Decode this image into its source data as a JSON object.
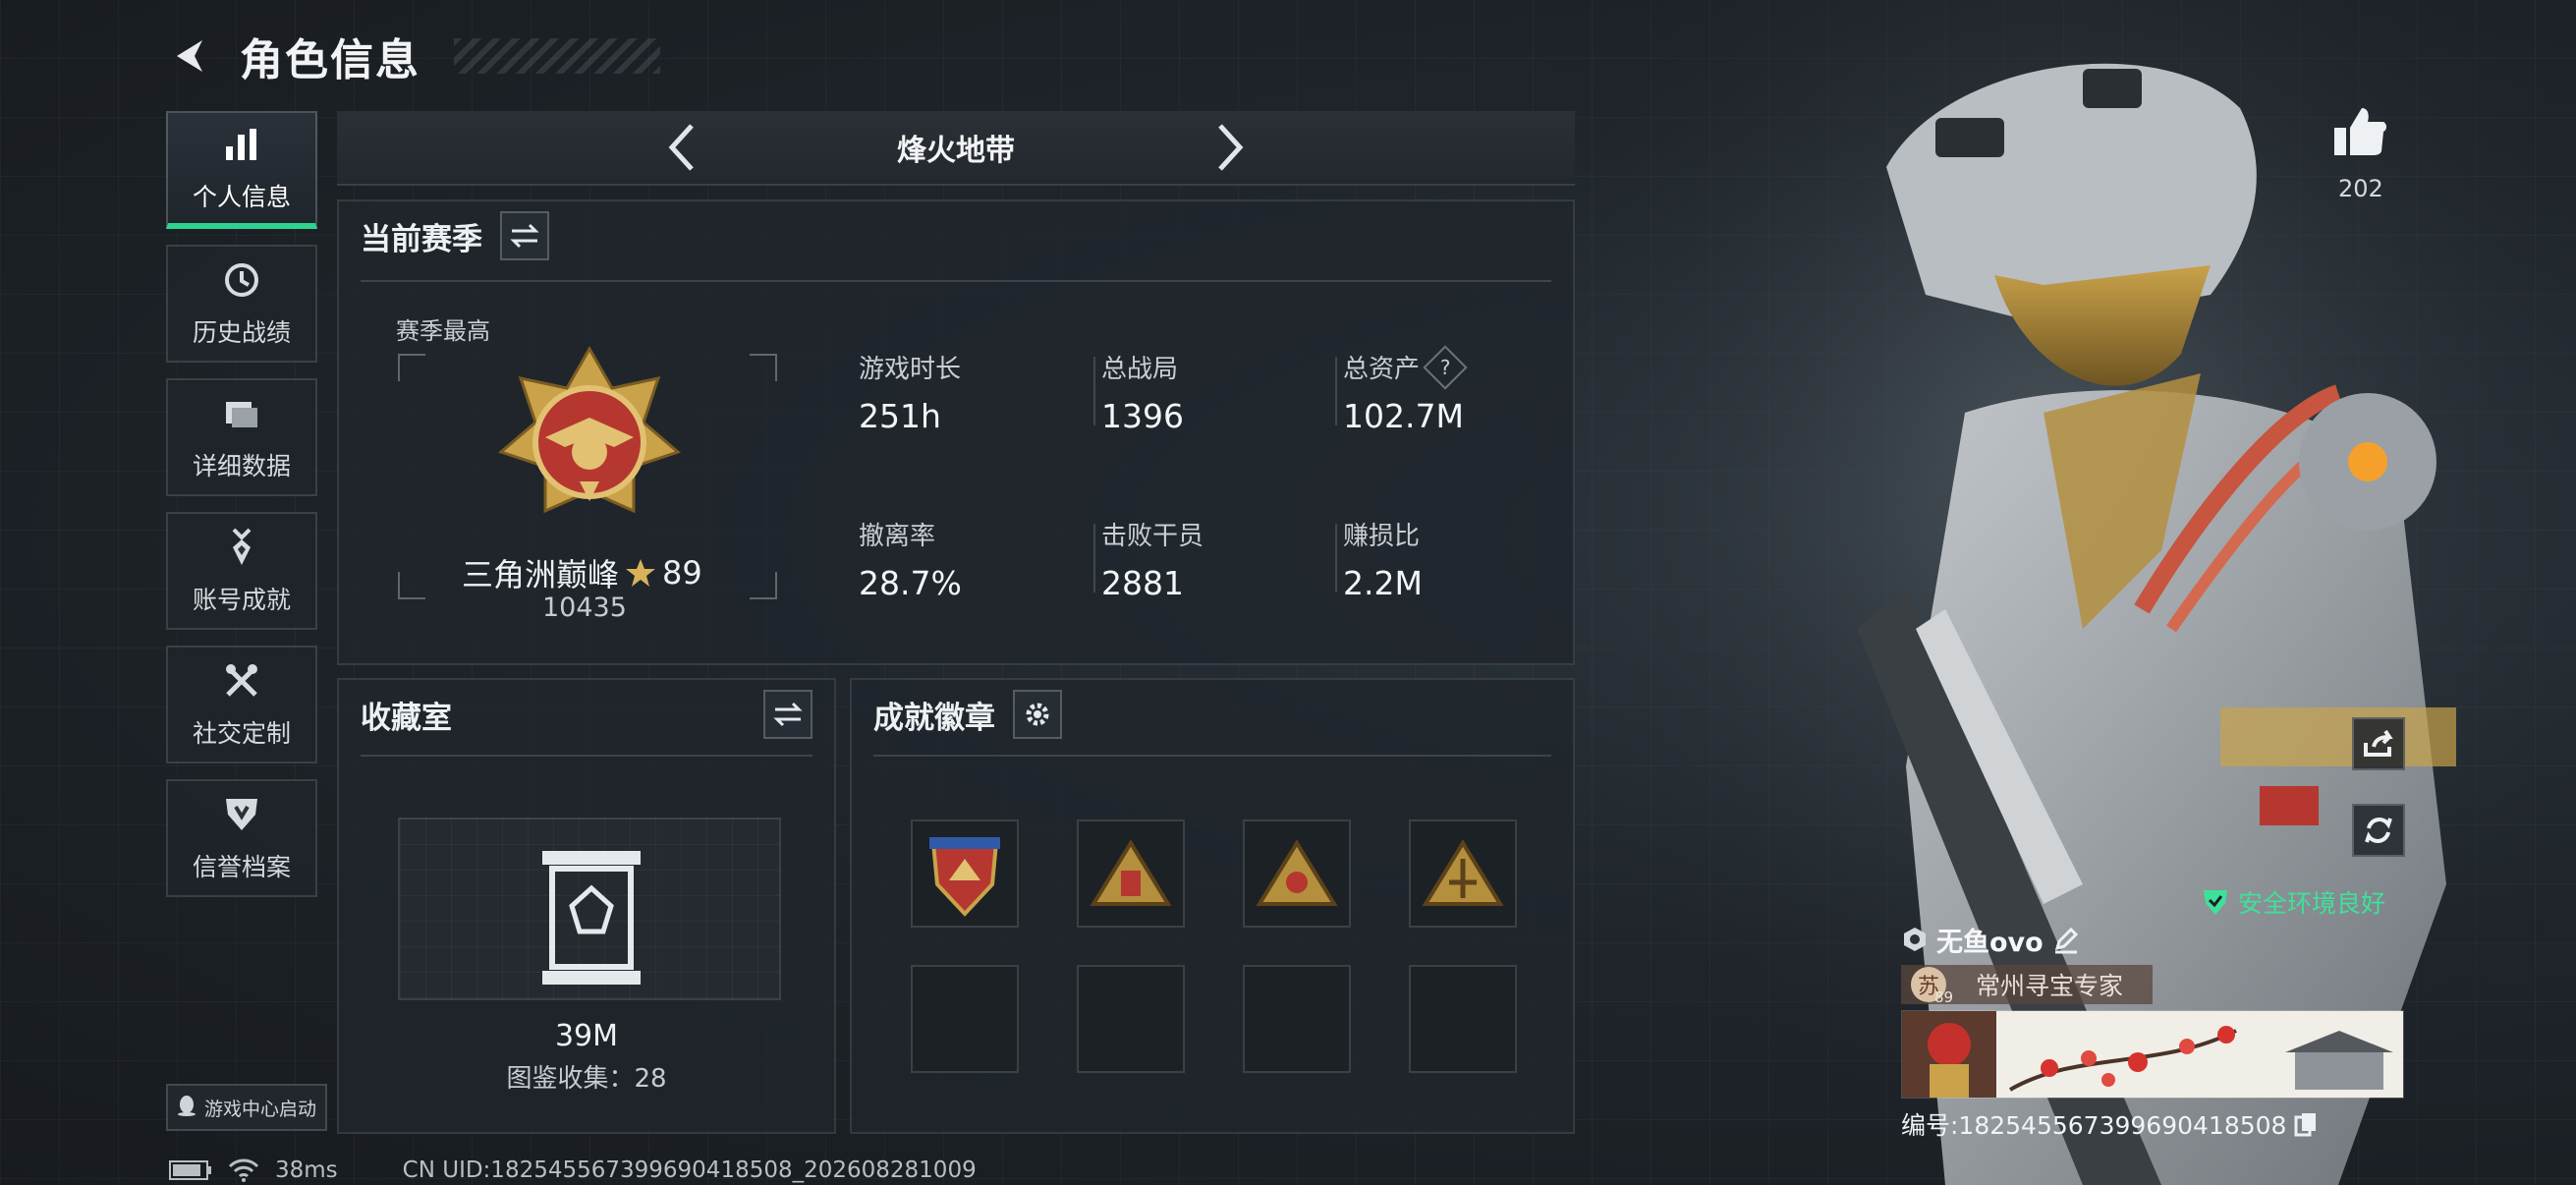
{
  "header": {
    "title": "角色信息"
  },
  "nav": {
    "items": [
      {
        "label": "个人信息",
        "icon": "bar-chart-icon",
        "active": true
      },
      {
        "label": "历史战绩",
        "icon": "history-icon"
      },
      {
        "label": "详细数据",
        "icon": "folder-icon"
      },
      {
        "label": "账号成就",
        "icon": "medal-icon"
      },
      {
        "label": "社交定制",
        "icon": "tools-icon"
      },
      {
        "label": "信誉档案",
        "icon": "shield-icon"
      }
    ],
    "launch_label": "游戏中心启动"
  },
  "map_selector": {
    "current": "烽火地带"
  },
  "season": {
    "title": "当前赛季",
    "best_label": "赛季最高",
    "rank_name": "三角洲巅峰",
    "rank_stars": "89",
    "rank_score": "10435",
    "stats": [
      {
        "label": "游戏时长",
        "value": "251h"
      },
      {
        "label": "总战局",
        "value": "1396"
      },
      {
        "label": "总资产",
        "value": "102.7M",
        "help": "?"
      },
      {
        "label": "撤离率",
        "value": "28.7%"
      },
      {
        "label": "击败干员",
        "value": "2881"
      },
      {
        "label": "赚损比",
        "value": "2.2M"
      }
    ]
  },
  "collection": {
    "title": "收藏室",
    "value": "39M",
    "count_text": "图鉴收集：28"
  },
  "badges": {
    "title": "成就徽章",
    "filled": 4,
    "total": 8
  },
  "social": {
    "like_count": "202",
    "security_text": "安全环境良好"
  },
  "player": {
    "name": "无鱼ovo",
    "avatar_char": "苏",
    "level": "89",
    "title": "常州寻宝专家",
    "uid_text": "编号:18254556739969041850​8"
  },
  "status": {
    "ping": "38ms",
    "uid_line": "CN UID:18254556739969041850​8_202608281009"
  },
  "colors": {
    "accent": "#2fd28f",
    "secure": "#3fe19a",
    "gold": "#c9a24a",
    "badge_red": "#b5372f"
  }
}
